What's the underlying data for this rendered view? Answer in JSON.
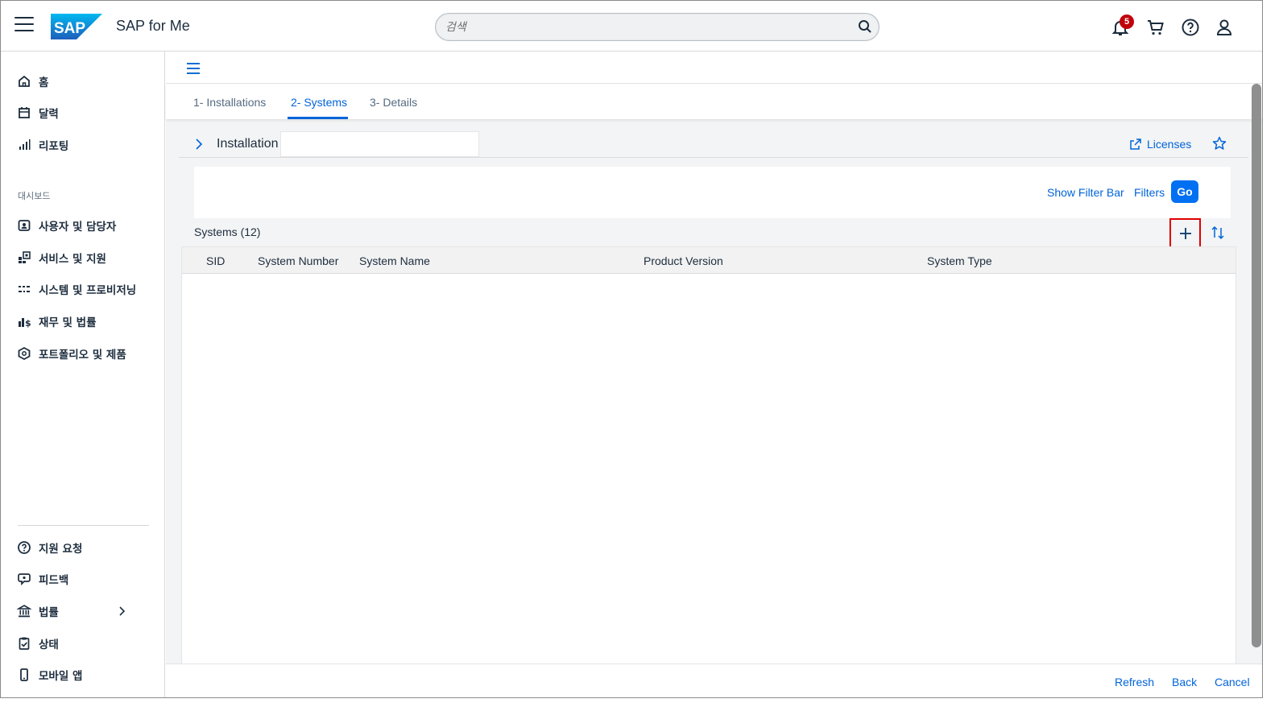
{
  "shell": {
    "logo_text": "SAP",
    "title": "SAP for Me",
    "search_placeholder": "검색",
    "notification_count": "5"
  },
  "sidenav": {
    "items": [
      {
        "label": "홈",
        "icon": "home-icon"
      },
      {
        "label": "달력",
        "icon": "calendar-icon"
      },
      {
        "label": "리포팅",
        "icon": "bar-chart-icon"
      }
    ],
    "section_label": "대시보드",
    "dashboard_items": [
      {
        "label": "사용자 및 담당자",
        "icon": "contacts-icon"
      },
      {
        "label": "서비스 및 지원",
        "icon": "services-icon"
      },
      {
        "label": "시스템 및 프로비저닝",
        "icon": "systems-icon"
      },
      {
        "label": "재무 및 법률",
        "icon": "finance-icon"
      },
      {
        "label": "포트폴리오 및 제품",
        "icon": "product-icon"
      }
    ],
    "bottom_items": [
      {
        "label": "지원 요청",
        "icon": "help-circle-icon"
      },
      {
        "label": "피드백",
        "icon": "feedback-icon"
      },
      {
        "label": "법률",
        "icon": "bank-icon"
      },
      {
        "label": "상태",
        "icon": "clipboard-check-icon"
      },
      {
        "label": "모바일 앱",
        "icon": "mobile-icon"
      }
    ]
  },
  "tabs": [
    {
      "label": "1- Installations",
      "active": false
    },
    {
      "label": "2- Systems",
      "active": true
    },
    {
      "label": "3- Details",
      "active": false
    }
  ],
  "installation": {
    "label": "Installation",
    "value": "",
    "licenses_link": "Licenses"
  },
  "filter_bar": {
    "show_filter_bar": "Show Filter Bar",
    "filters": "Filters",
    "go": "Go"
  },
  "table": {
    "title": "Systems (12)",
    "columns": [
      "SID",
      "System Number",
      "System Name",
      "Product Version",
      "System Type"
    ],
    "rows": []
  },
  "footer": {
    "refresh": "Refresh",
    "back": "Back",
    "cancel": "Cancel"
  },
  "colors": {
    "accent": "#0064d9",
    "go_button": "#0070f2",
    "badge": "#c0000b",
    "highlight_box": "#e00000"
  }
}
